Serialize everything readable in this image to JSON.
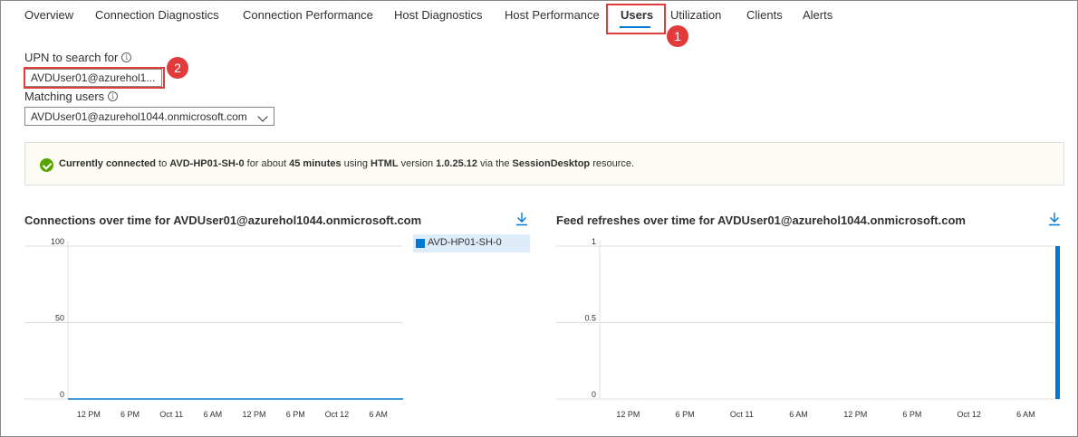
{
  "tabs": [
    {
      "label": "Overview",
      "active": false
    },
    {
      "label": "Connection Diagnostics",
      "active": false
    },
    {
      "label": "Connection Performance",
      "active": false
    },
    {
      "label": "Host Diagnostics",
      "active": false
    },
    {
      "label": "Host Performance",
      "active": false
    },
    {
      "label": "Users",
      "active": true
    },
    {
      "label": "Utilization",
      "active": false
    },
    {
      "label": "Clients",
      "active": false
    },
    {
      "label": "Alerts",
      "active": false
    }
  ],
  "callouts": {
    "one": "1",
    "two": "2"
  },
  "search": {
    "label": "UPN to search for",
    "value": "AVDUser01@azurehol1..."
  },
  "matching": {
    "label": "Matching users",
    "selected": "AVDUser01@azurehol1044.onmicrosoft.com"
  },
  "status": {
    "icon": "success-check-icon",
    "prefix": "Currently connected",
    "to": " to ",
    "host": "AVD-HP01-SH-0",
    "for_about": " for about ",
    "duration": "45 minutes",
    "using": " using ",
    "client": "HTML",
    "version_label": " version ",
    "version": "1.0.25.12",
    "via": " via the ",
    "resource": "SessionDesktop",
    "suffix": " resource."
  },
  "colors": {
    "accent": "#0078d4",
    "success": "#57a300",
    "callout": "#e23b3b"
  },
  "charts": {
    "connections": {
      "title": "Connections over time for AVDUser01@azurehol1044.onmicrosoft.com"
    },
    "feed": {
      "title": "Feed refreshes over time for AVDUser01@azurehol1044.onmicrosoft.com"
    }
  },
  "chart_data": [
    {
      "type": "line",
      "title": "Connections over time for AVDUser01@azurehol1044.onmicrosoft.com",
      "xlabel": "",
      "ylabel": "",
      "x_ticks": [
        "12 PM",
        "6 PM",
        "Oct 11",
        "6 AM",
        "12 PM",
        "6 PM",
        "Oct 12",
        "6 AM"
      ],
      "y_ticks": [
        "100",
        "50",
        "0"
      ],
      "ylim": [
        0,
        100
      ],
      "series": [
        {
          "name": "AVD-HP01-SH-0",
          "values": [
            0,
            0,
            0,
            0,
            0,
            0,
            0,
            0
          ]
        }
      ],
      "legend": "right",
      "grid": true
    },
    {
      "type": "bar",
      "title": "Feed refreshes over time for AVDUser01@azurehol1044.onmicrosoft.com",
      "xlabel": "",
      "ylabel": "",
      "x_ticks": [
        "12 PM",
        "6 PM",
        "Oct 11",
        "6 AM",
        "12 PM",
        "6 PM",
        "Oct 12",
        "6 AM"
      ],
      "y_ticks": [
        "1",
        "0.5",
        "0"
      ],
      "ylim": [
        0,
        1
      ],
      "series": [
        {
          "values": [
            0,
            0,
            0,
            0,
            0,
            0,
            0,
            0,
            1
          ]
        }
      ],
      "grid": true
    }
  ]
}
